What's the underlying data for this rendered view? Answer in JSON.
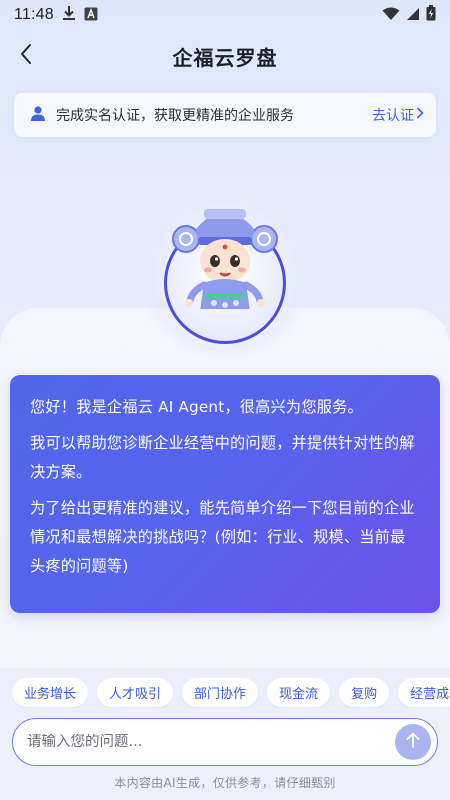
{
  "status_bar": {
    "time": "11:48",
    "icons": [
      "download-icon",
      "translate-a-icon",
      "wifi-icon",
      "signal-icon",
      "battery-icon"
    ]
  },
  "nav": {
    "title": "企福云罗盘",
    "back_icon": "chevron-left-icon"
  },
  "verify_banner": {
    "icon": "user-icon",
    "text": "完成实名认证，获取更精准的企业服务",
    "link_label": "去认证"
  },
  "chat": {
    "paragraphs": [
      "您好！我是企福云 AI Agent，很高兴为您服务。",
      "我可以帮助您诊断企业经营中的问题，并提供针对性的解决方案。",
      "为了给出更精准的建议，能先简单介绍一下您目前的企业情况和最想解决的挑战吗？(例如：行业、规模、当前最头疼的问题等)"
    ]
  },
  "chips": [
    "业务增长",
    "人才吸引",
    "部门协作",
    "现金流",
    "复购",
    "经营成本"
  ],
  "input": {
    "placeholder": "请输入您的问题..."
  },
  "disclaimer": "本内容由AI生成，仅供参考，请仔细甄别",
  "colors": {
    "accent": "#3f63e0",
    "bubble_start": "#4f66ea",
    "bubble_end": "#6d52ea",
    "send_button": "#a9b5f1"
  }
}
